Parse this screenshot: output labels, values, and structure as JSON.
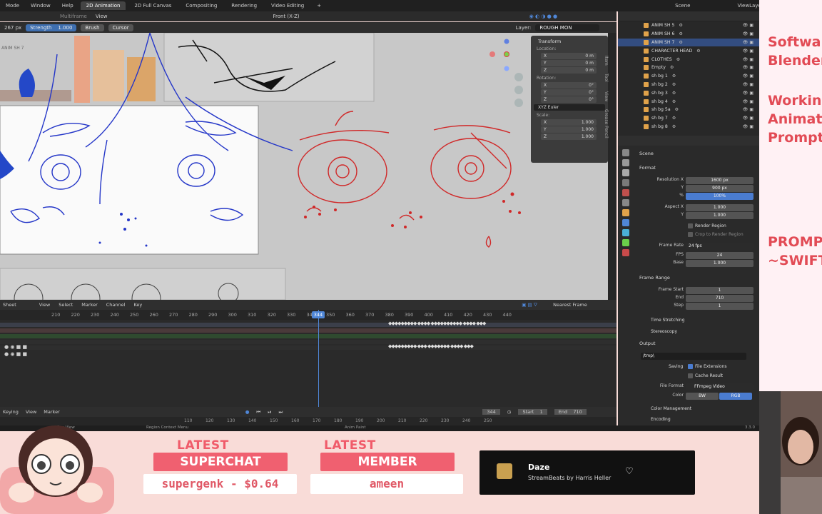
{
  "topbar": {
    "menus": [
      "Mode",
      "Window",
      "Help"
    ],
    "tabs": [
      "2D Animation",
      "2D Full Canvas",
      "Compositing",
      "Rendering",
      "Video Editing"
    ],
    "add": "+",
    "scene": "Scene",
    "view_layer": "ViewLayer"
  },
  "header2": {
    "tool": "Multiframe",
    "view": "View",
    "orientation": "Front (X-Z)"
  },
  "toolbar": {
    "size": "267 px",
    "strength_label": "Strength",
    "strength_value": "1.000",
    "brush": "Brush",
    "cursor": "Cursor",
    "layer_label": "Layer:",
    "layer_value": "ROUGH MON"
  },
  "viewport": {
    "object_label": "ANIM SH 7"
  },
  "npanel": {
    "title": "Transform",
    "location_label": "Location:",
    "location": [
      {
        "axis": "X",
        "value": "0 m"
      },
      {
        "axis": "Y",
        "value": "0 m"
      },
      {
        "axis": "Z",
        "value": "0 m"
      }
    ],
    "rotation_label": "Rotation:",
    "rotation": [
      {
        "axis": "X",
        "value": "0°"
      },
      {
        "axis": "Y",
        "value": "0°"
      },
      {
        "axis": "Z",
        "value": "0°"
      }
    ],
    "euler": "XYZ Euler",
    "scale_label": "Scale:",
    "scale": [
      {
        "axis": "X",
        "value": "1.000"
      },
      {
        "axis": "Y",
        "value": "1.000"
      },
      {
        "axis": "Z",
        "value": "1.000"
      }
    ]
  },
  "sidetabs": [
    "Item",
    "Tool",
    "View",
    "Grease Pencil"
  ],
  "outliner": {
    "rows": [
      {
        "name": "ANIM SH 5",
        "selected": false
      },
      {
        "name": "ANIM SH 6",
        "selected": false
      },
      {
        "name": "ANIM SH 7",
        "selected": true
      },
      {
        "name": "CHARACTER HEAD",
        "selected": false
      },
      {
        "name": "CLOTHES",
        "selected": false
      },
      {
        "name": "Empty",
        "selected": false
      },
      {
        "name": "sh bg 1",
        "selected": false
      },
      {
        "name": "sh bg 2",
        "selected": false
      },
      {
        "name": "sh bg 3",
        "selected": false
      },
      {
        "name": "sh bg 4",
        "selected": false
      },
      {
        "name": "sh bg 5a",
        "selected": false
      },
      {
        "name": "sh bg 7",
        "selected": false
      },
      {
        "name": "sh bg 8",
        "selected": false
      }
    ]
  },
  "properties": {
    "context": "Scene",
    "format_section": "Format",
    "resolution_x_label": "Resolution X",
    "resolution_x": "1600 px",
    "resolution_y_label": "Y",
    "resolution_y": "900 px",
    "percent_label": "%",
    "percent": "100%",
    "aspect_x_label": "Aspect X",
    "aspect_x": "1.000",
    "aspect_y_label": "Y",
    "aspect_y": "1.000",
    "render_region": "Render Region",
    "crop": "Crop to Render Region",
    "frame_rate_label": "Frame Rate",
    "frame_rate": "24 fps",
    "fps_label": "FPS",
    "fps": "24",
    "base_label": "Base",
    "base": "1.000",
    "frame_range_section": "Frame Range",
    "frame_start_label": "Frame Start",
    "frame_start": "1",
    "end_label": "End",
    "end": "710",
    "step_label": "Step",
    "step": "1",
    "time_stretching": "Time Stretching",
    "stereoscopy": "Stereoscopy",
    "output_section": "Output",
    "output_path": "/tmp\\",
    "saving_label": "Saving",
    "file_extensions": "File Extensions",
    "cache_result": "Cache Result",
    "file_format_label": "File Format",
    "file_format": "FFmpeg Video",
    "color_label": "Color",
    "color_bw": "BW",
    "color_rgb": "RGB",
    "color_management": "Color Management",
    "encoding": "Encoding"
  },
  "timeline": {
    "menus": [
      "Sheet",
      "View",
      "Select",
      "Marker",
      "Channel",
      "Key"
    ],
    "snap": "Nearest Frame",
    "ruler": [
      "210",
      "220",
      "230",
      "240",
      "250",
      "260",
      "270",
      "280",
      "290",
      "300",
      "310",
      "320",
      "330",
      "340",
      "350",
      "360",
      "370",
      "380",
      "390",
      "400",
      "410",
      "420",
      "430",
      "440"
    ],
    "current_frame": "344"
  },
  "playback": {
    "menus": [
      "Keying",
      "View",
      "Marker"
    ],
    "frame": "344",
    "start_label": "Start",
    "start": "1",
    "end_label": "End",
    "end": "710",
    "ruler": [
      "110",
      "120",
      "130",
      "140",
      "150",
      "160",
      "170",
      "180",
      "190",
      "200",
      "210",
      "220",
      "230",
      "240",
      "250"
    ]
  },
  "statusbar": {
    "left": "Pan View",
    "mid": "Region Context Menu",
    "right": "Anim Paint",
    "version": "3.3.0"
  },
  "overlay": {
    "right_text": [
      "Softwar",
      "Blender",
      "",
      "Working",
      "Animati",
      "Prompt",
      "",
      "",
      "PROMPT",
      "~SWIFT"
    ],
    "latest": "LATEST",
    "superchat_label": "SUPERCHAT",
    "superchat_value": "supergenk - $0.64",
    "member_label": "MEMBER",
    "member_value": "ameen",
    "music_title": "Daze",
    "music_artist": "StreamBeats by Harris Heller"
  },
  "colors": {
    "accent_blue": "#4f86d6",
    "overlay_red": "#f06070",
    "overlay_bg": "#f9dcd8"
  }
}
